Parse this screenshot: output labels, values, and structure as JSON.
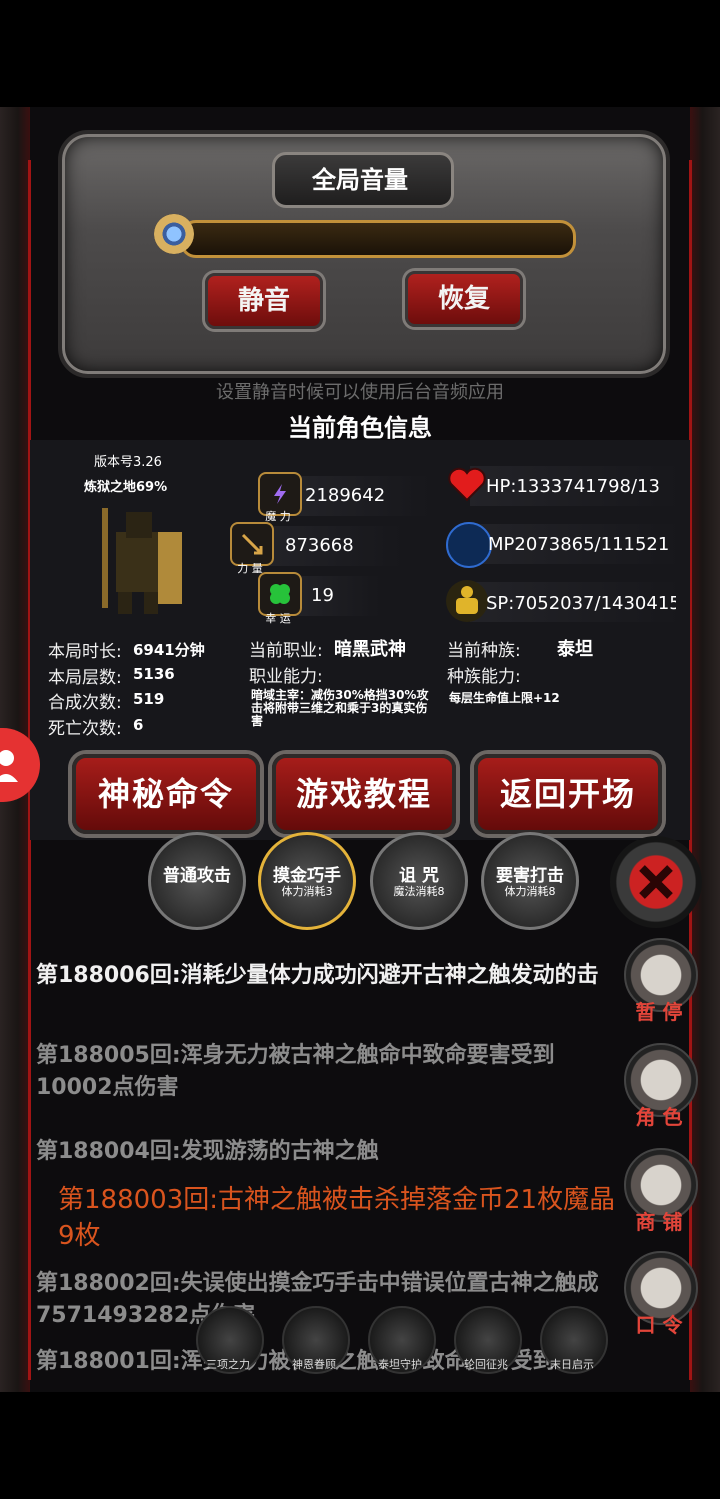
{
  "volume": {
    "title": "全局音量",
    "mute_label": "静音",
    "restore_label": "恢复",
    "hint": "设置静音时候可以使用后台音频应用"
  },
  "info": {
    "title": "当前角色信息",
    "version": "版本号3.26",
    "realm": "炼狱之地69%",
    "stats": {
      "magic_value": "2189642",
      "magic_label": "魔 力",
      "strength_value": "873668",
      "strength_label": "力 量",
      "luck_value": "19",
      "luck_label": "幸 运",
      "hp": "HP:1333741798/13",
      "mp": "MP2073865/111521",
      "sp": "SP:7052037/1430415"
    },
    "left": {
      "time_label": "本局时长:",
      "time_value": "6941分钟",
      "floors_label": "本局层数:",
      "floors_value": "5136",
      "merges_label": "合成次数:",
      "merges_value": "519",
      "deaths_label": "死亡次数:",
      "deaths_value": "6"
    },
    "mid": {
      "job_label": "当前职业:",
      "job_value": "暗黑武神",
      "job_ability_label": "职业能力:",
      "job_ability_desc": "暗域主宰：减伤30%格挡30%攻击将附带三维之和乘于3的真实伤害"
    },
    "right": {
      "race_label": "当前种族:",
      "race_value": "泰坦",
      "race_ability_label": "种族能力:",
      "race_ability_desc": "每层生命值上限+12"
    },
    "buttons": [
      "神秘命令",
      "游戏教程",
      "返回开场"
    ]
  },
  "skills": [
    {
      "name": "普通攻击",
      "cost": ""
    },
    {
      "name": "摸金巧手",
      "cost": "体力消耗3"
    },
    {
      "name": "诅 咒",
      "cost": "魔法消耗8"
    },
    {
      "name": "要害打击",
      "cost": "体力消耗8"
    }
  ],
  "log": [
    "第188006回:消耗少量体力成功闪避开古神之触发动的击",
    "第188005回:浑身无力被古神之触命中致命要害受到10002点伤害",
    "第188004回:发现游荡的古神之触",
    "第188003回:古神之触被击杀掉落金币21枚魔晶9枚",
    "第188002回:失误使出摸金巧手击中错误位置古神之触成7571493282点伤害",
    "第188001回:浑身无力被古神之触命中致命要害受到117"
  ],
  "side": [
    "暂 停",
    "角 色",
    "商 铺",
    "口 令"
  ],
  "bottom_icons": [
    "三项之力",
    "神恩眷顾",
    "泰坦守护",
    "轮回征兆",
    "末日启示"
  ]
}
